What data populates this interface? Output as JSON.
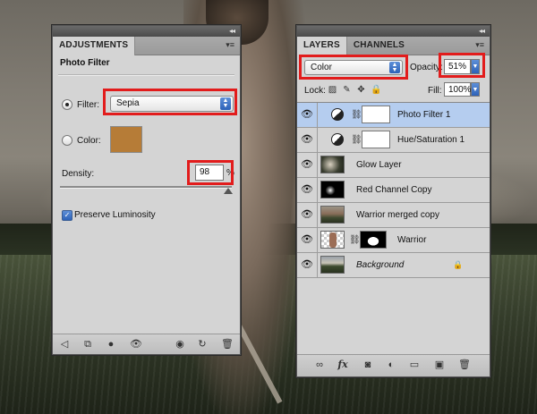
{
  "adjustments": {
    "tab_label": "ADJUSTMENTS",
    "title": "Photo Filter",
    "filter_label": "Filter:",
    "filter_value": "Sepia",
    "color_label": "Color:",
    "color_swatch": "#b67c37",
    "density_label": "Density:",
    "density_value": "98",
    "density_unit": "%",
    "density_level_percent": 98,
    "preserve_label": "Preserve Luminosity",
    "preserve_checked": true,
    "footer_icons": [
      "back-arrow-icon",
      "clip-to-layer-icon",
      "mask-visibility-icon",
      "eye-icon",
      "view-previous-icon",
      "reset-icon",
      "trash-icon"
    ]
  },
  "layers": {
    "tabs": [
      "LAYERS",
      "CHANNELS"
    ],
    "blend_mode": "Color",
    "opacity_label": "Opacity:",
    "opacity_value": "51%",
    "lock_label": "Lock:",
    "fill_label": "Fill:",
    "fill_value": "100%",
    "items": [
      {
        "name": "Photo Filter 1",
        "selected": true
      },
      {
        "name": "Hue/Saturation 1",
        "selected": false
      },
      {
        "name": "Glow Layer",
        "selected": false
      },
      {
        "name": "Red Channel Copy",
        "selected": false
      },
      {
        "name": "Warrior merged copy",
        "selected": false
      },
      {
        "name": "Warrior",
        "selected": false
      },
      {
        "name": "Background",
        "selected": false
      }
    ],
    "footer_icons": [
      "link-icon",
      "fx-icon",
      "add-mask-icon",
      "adjustment-layer-icon",
      "group-icon",
      "new-layer-icon",
      "trash-icon"
    ]
  },
  "colors": {
    "highlight": "#e21c1c",
    "selection": "#b5cdef",
    "panel": "#d4d4d4"
  }
}
